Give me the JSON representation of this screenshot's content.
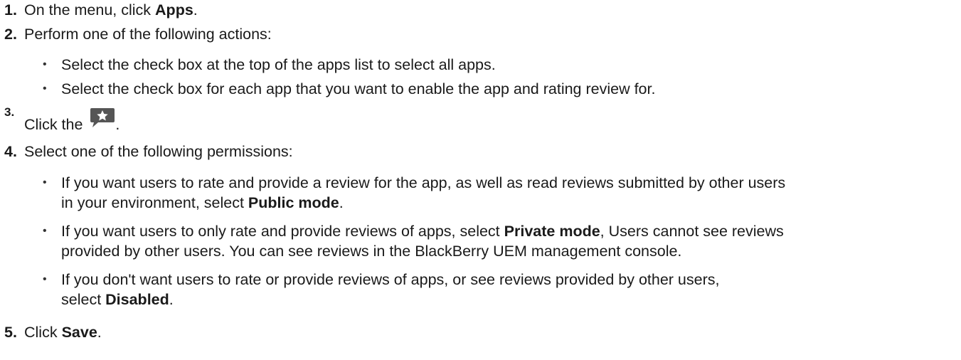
{
  "steps": [
    {
      "num": "1.",
      "pre": "On the menu, click ",
      "bold": "Apps",
      "post": "."
    },
    {
      "num": "2.",
      "text": "Perform one of the following actions:",
      "bullets": [
        "Select the check box at the top of the apps list to select all apps.",
        "Select the check box for each app that you want to enable the app and rating review for."
      ]
    },
    {
      "num": "3.",
      "pre": "Click the ",
      "post": ".",
      "icon": "star-review-icon"
    },
    {
      "num": "4.",
      "text": "Select one of the following permissions:",
      "bullets": [
        {
          "line1": "If you want users to rate and provide a review for the app, as well as read reviews submitted by other users",
          "line2_pre": "in your environment, select ",
          "line2_bold": "Public mode",
          "line2_post": "."
        },
        {
          "line1_pre": "If you want users to only rate and provide reviews of apps, select ",
          "line1_bold": "Private mode",
          "line1_post": ", Users cannot see reviews",
          "line2": "provided by other users. You can see reviews in the BlackBerry UEM management console."
        },
        {
          "line1": "If you don't want users to rate or provide reviews of apps, or see reviews provided by other users,",
          "line2_pre": "select ",
          "line2_bold": "Disabled",
          "line2_post": "."
        }
      ]
    },
    {
      "num": "5.",
      "pre": "Click ",
      "bold": "Save",
      "post": "."
    }
  ],
  "bullet_glyph": "•",
  "colors": {
    "text": "#1a1a1a",
    "icon_bg": "#555555",
    "icon_star": "#ffffff"
  }
}
